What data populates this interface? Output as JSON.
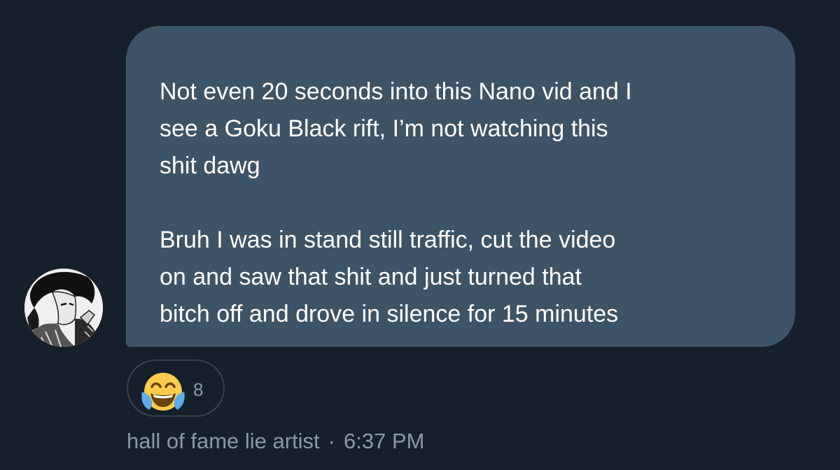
{
  "message": {
    "paragraph_1": "Not even 20 seconds into this Nano vid and I\nsee a Goku Black rift, I’m not watching this\nshit dawg",
    "paragraph_2": "Bruh I was in stand still traffic, cut the video\non and saw that shit and just turned that\nbitch off and drove in silence for 15 minutes"
  },
  "reaction": {
    "emoji": "face-with-tears-of-joy-icon",
    "count": "8"
  },
  "meta": {
    "sender": "hall of fame lie artist",
    "separator": "·",
    "time": "6:37 PM"
  },
  "colors": {
    "background": "#15202b",
    "bubble": "#3d5466",
    "message_text": "#ffffff",
    "secondary_text": "#8b98a5",
    "reaction_border": "#38444d"
  }
}
